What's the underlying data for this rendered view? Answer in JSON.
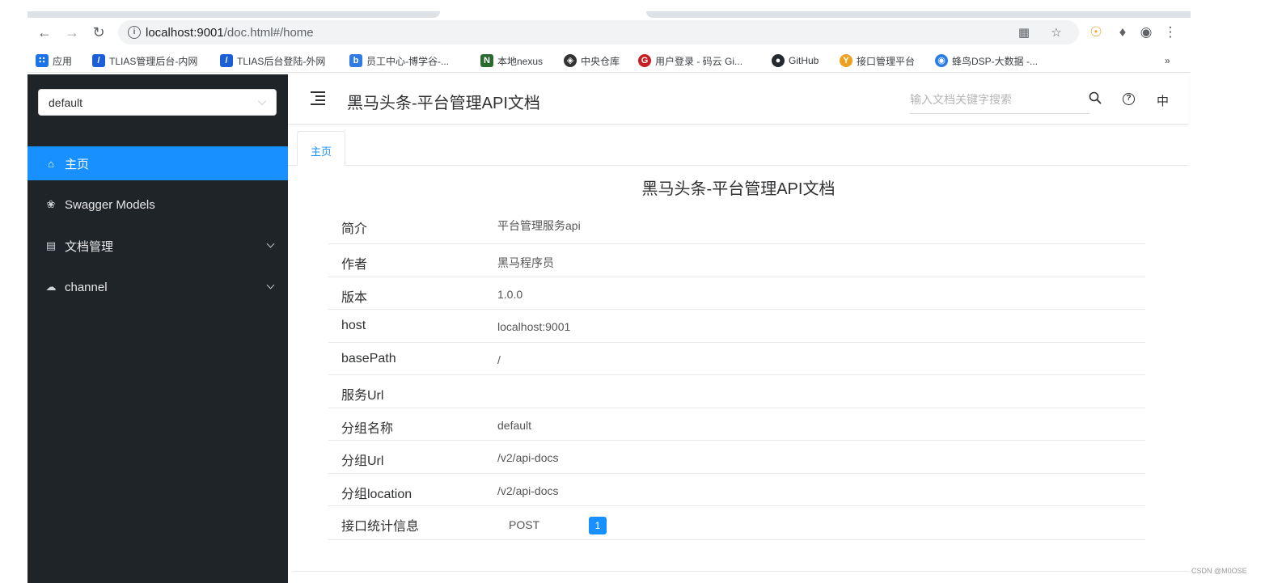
{
  "browser": {
    "url_host": "localhost:9001",
    "url_path": "/doc.html#/home",
    "bookmarks": [
      {
        "label": "应用",
        "icon": "apps-grid-icon",
        "color": "#1a73e8"
      },
      {
        "label": "TLIAS管理后台-内网",
        "icon": "tlias-icon",
        "color": "#1a5fd8"
      },
      {
        "label": "TLIAS后台登陆-外网",
        "icon": "tlias-icon",
        "color": "#1a5fd8"
      },
      {
        "label": "员工中心-博学谷-...",
        "icon": "boxuegu-icon",
        "color": "#2f7ae5"
      },
      {
        "label": "本地nexus",
        "icon": "nexus-icon",
        "color": "#2b6a2f"
      },
      {
        "label": "中央仓库",
        "icon": "maven-icon",
        "color": "#333333"
      },
      {
        "label": "用户登录 - 码云 Gi...",
        "icon": "gitee-icon",
        "color": "#c71d23"
      },
      {
        "label": "GitHub",
        "icon": "github-icon",
        "color": "#24292e"
      },
      {
        "label": "接口管理平台",
        "icon": "yapi-icon",
        "color": "#f0a020"
      },
      {
        "label": "蜂鸟DSP-大数据 -...",
        "icon": "globe-icon",
        "color": "#2a7de1"
      }
    ],
    "overflow": "»"
  },
  "sidebar": {
    "group_value": "default",
    "items": [
      {
        "label": "主页",
        "icon": "home-icon",
        "active": true
      },
      {
        "label": "Swagger Models",
        "icon": "models-icon",
        "active": false
      },
      {
        "label": "文档管理",
        "icon": "document-icon",
        "active": false
      },
      {
        "label": "channel",
        "icon": "cloud-icon",
        "active": false
      }
    ]
  },
  "header": {
    "title": "黑马头条-平台管理API文档",
    "search_placeholder": "输入文档关键字搜索",
    "lang": "中"
  },
  "tabs": [
    {
      "label": "主页"
    }
  ],
  "doc": {
    "title": "黑马头条-平台管理API文档",
    "rows": [
      {
        "key": "简介",
        "value": "平台管理服务api"
      },
      {
        "key": "作者",
        "value": "黑马程序员"
      },
      {
        "key": "版本",
        "value": "1.0.0"
      },
      {
        "key": "host",
        "value": "localhost:9001"
      },
      {
        "key": "basePath",
        "value": "/"
      },
      {
        "key": "服务Url",
        "value": ""
      },
      {
        "key": "分组名称",
        "value": "default"
      },
      {
        "key": "分组Url",
        "value": "/v2/api-docs"
      },
      {
        "key": "分组location",
        "value": "/v2/api-docs"
      },
      {
        "key": "接口统计信息",
        "value": ""
      }
    ],
    "stats": {
      "method": "POST",
      "count": "1"
    }
  },
  "watermark": "CSDN @M0OSE",
  "colors": {
    "accent": "#1890ff",
    "sidebar_bg": "#1f2429"
  }
}
